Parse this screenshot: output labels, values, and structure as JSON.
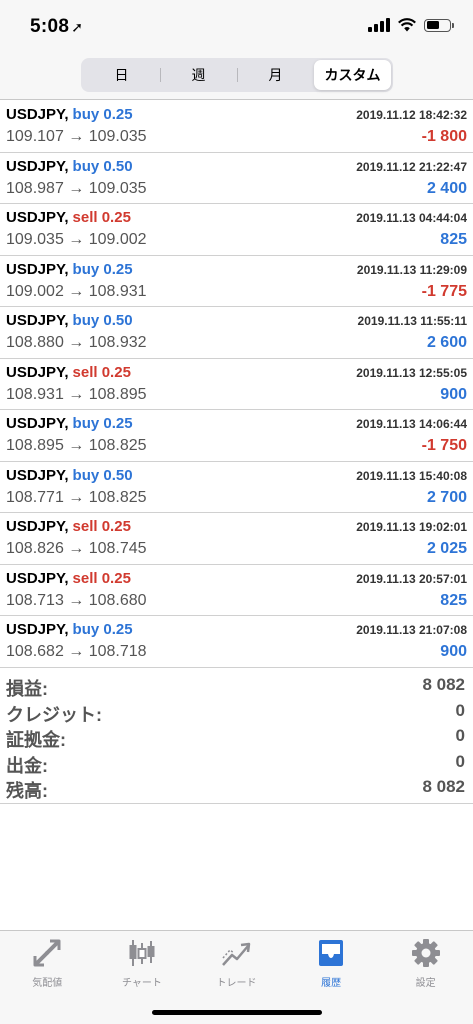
{
  "status_bar": {
    "time": "5:08"
  },
  "period_tabs": [
    {
      "label": "日",
      "active": false
    },
    {
      "label": "週",
      "active": false
    },
    {
      "label": "月",
      "active": false
    },
    {
      "label": "カスタム",
      "active": true
    }
  ],
  "trades": [
    {
      "symbol": "USDJPY,",
      "side": "buy",
      "volume": "0.25",
      "side_label": "buy 0.25",
      "time": "2019.11.12 18:42:32",
      "prices": "109.107 → 109.035",
      "profit": "-1 800"
    },
    {
      "symbol": "USDJPY,",
      "side": "buy",
      "volume": "0.50",
      "side_label": "buy 0.50",
      "time": "2019.11.12 21:22:47",
      "prices": "108.987 → 109.035",
      "profit": "2 400"
    },
    {
      "symbol": "USDJPY,",
      "side": "sell",
      "volume": "0.25",
      "side_label": "sell 0.25",
      "time": "2019.11.13 04:44:04",
      "prices": "109.035 → 109.002",
      "profit": "825"
    },
    {
      "symbol": "USDJPY,",
      "side": "buy",
      "volume": "0.25",
      "side_label": "buy 0.25",
      "time": "2019.11.13 11:29:09",
      "prices": "109.002 → 108.931",
      "profit": "-1 775"
    },
    {
      "symbol": "USDJPY,",
      "side": "buy",
      "volume": "0.50",
      "side_label": "buy 0.50",
      "time": "2019.11.13 11:55:11",
      "prices": "108.880 → 108.932",
      "profit": "2 600"
    },
    {
      "symbol": "USDJPY,",
      "side": "sell",
      "volume": "0.25",
      "side_label": "sell 0.25",
      "time": "2019.11.13 12:55:05",
      "prices": "108.931 → 108.895",
      "profit": "900"
    },
    {
      "symbol": "USDJPY,",
      "side": "buy",
      "volume": "0.25",
      "side_label": "buy 0.25",
      "time": "2019.11.13 14:06:44",
      "prices": "108.895 → 108.825",
      "profit": "-1 750"
    },
    {
      "symbol": "USDJPY,",
      "side": "buy",
      "volume": "0.50",
      "side_label": "buy 0.50",
      "time": "2019.11.13 15:40:08",
      "prices": "108.771 → 108.825",
      "profit": "2 700"
    },
    {
      "symbol": "USDJPY,",
      "side": "sell",
      "volume": "0.25",
      "side_label": "sell 0.25",
      "time": "2019.11.13 19:02:01",
      "prices": "108.826 → 108.745",
      "profit": "2 025"
    },
    {
      "symbol": "USDJPY,",
      "side": "sell",
      "volume": "0.25",
      "side_label": "sell 0.25",
      "time": "2019.11.13 20:57:01",
      "prices": "108.713 → 108.680",
      "profit": "825"
    },
    {
      "symbol": "USDJPY,",
      "side": "buy",
      "volume": "0.25",
      "side_label": "buy 0.25",
      "time": "2019.11.13 21:07:08",
      "prices": "108.682 → 108.718",
      "profit": "900"
    }
  ],
  "summary": [
    {
      "label": "損益:",
      "value": "8 082"
    },
    {
      "label": "クレジット:",
      "value": "0"
    },
    {
      "label": "証拠金:",
      "value": "0"
    },
    {
      "label": "出金:",
      "value": "0"
    },
    {
      "label": "残高:",
      "value": "8 082"
    }
  ],
  "tabbar": [
    {
      "label": "気配値",
      "icon": "quotes-icon",
      "active": false
    },
    {
      "label": "チャート",
      "icon": "chart-icon",
      "active": false
    },
    {
      "label": "トレード",
      "icon": "trade-icon",
      "active": false
    },
    {
      "label": "履歴",
      "icon": "history-icon",
      "active": true
    },
    {
      "label": "設定",
      "icon": "settings-icon",
      "active": false
    }
  ],
  "colors": {
    "buy": "#2d74d6",
    "sell": "#d13a2f",
    "active_tab": "#2d74d6",
    "inactive_tab": "#8e8e93"
  }
}
